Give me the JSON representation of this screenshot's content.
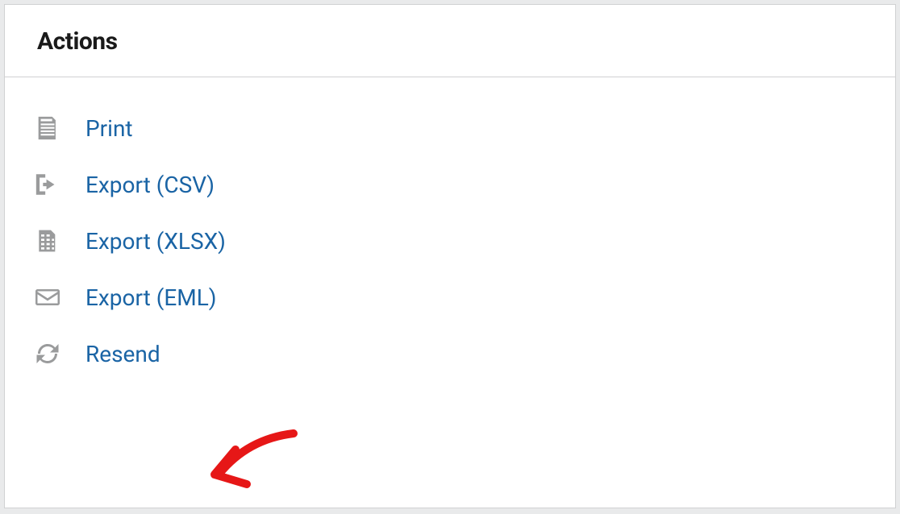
{
  "panel": {
    "title": "Actions",
    "actions": [
      {
        "label": "Print",
        "icon": "document-icon"
      },
      {
        "label": "Export (CSV)",
        "icon": "export-arrow-icon"
      },
      {
        "label": "Export (XLSX)",
        "icon": "spreadsheet-icon"
      },
      {
        "label": "Export (EML)",
        "icon": "mail-icon"
      },
      {
        "label": "Resend",
        "icon": "refresh-icon"
      }
    ]
  }
}
